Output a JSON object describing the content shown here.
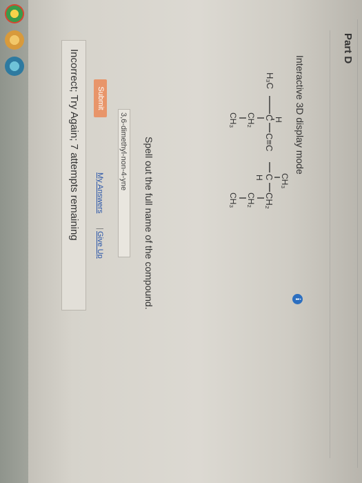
{
  "part": {
    "title": "Part D"
  },
  "display_mode": {
    "label": "Interactive 3D display mode",
    "info_icon": "info-icon"
  },
  "molecule": {
    "h3c": "H₃C",
    "h_top": "H",
    "c1": "C",
    "triple_bond": "C≡C",
    "c2": "C",
    "ch2_main": "CH₂",
    "ch3_top": "CH₃",
    "h_bottom": "H",
    "ch2_left": "CH₂",
    "ch3_left": "CH₃",
    "ch2_right": "CH₂",
    "ch3_right": "CH₃"
  },
  "question": {
    "prompt": "Spell out the full name of the compound.",
    "answer_value": "3,6-dimethyl-non-4-yne"
  },
  "actions": {
    "submit_label": "Submit",
    "my_answers_label": "My Answers",
    "separator": "|",
    "give_up_label": "Give Up"
  },
  "feedback": {
    "message": "Incorrect; Try Again; 7 attempts remaining"
  },
  "colors": {
    "submit": "#e8956a",
    "link": "#2a55a8",
    "info": "#2c6fc0"
  }
}
